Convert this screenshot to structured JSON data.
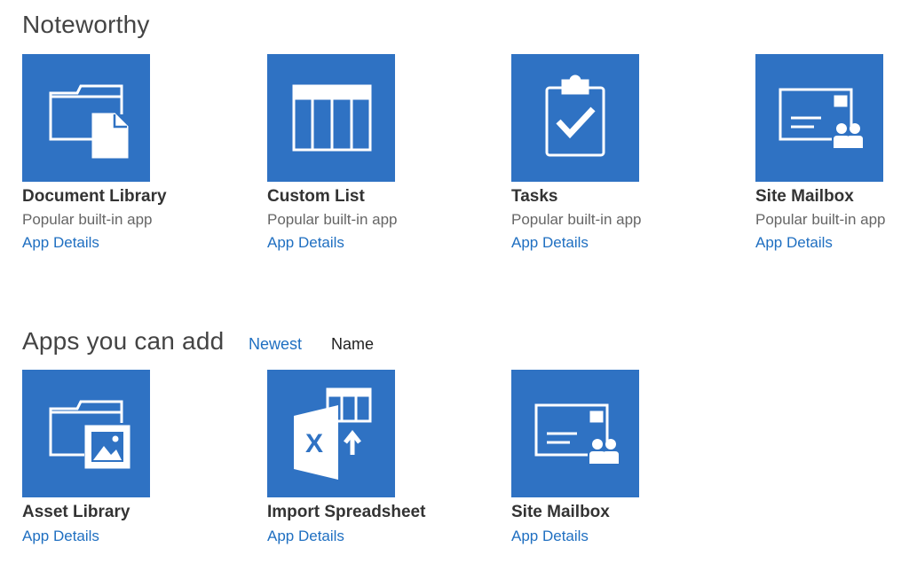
{
  "noteworthy": {
    "heading": "Noteworthy",
    "tiles": [
      {
        "title": "Document Library",
        "subtitle": "Popular built-in app",
        "link": "App Details",
        "icon": "document-library-icon"
      },
      {
        "title": "Custom List",
        "subtitle": "Popular built-in app",
        "link": "App Details",
        "icon": "custom-list-icon"
      },
      {
        "title": "Tasks",
        "subtitle": "Popular built-in app",
        "link": "App Details",
        "icon": "tasks-icon"
      },
      {
        "title": "Site Mailbox",
        "subtitle": "Popular built-in app",
        "link": "App Details",
        "icon": "site-mailbox-icon"
      }
    ]
  },
  "apps": {
    "heading": "Apps you can add",
    "sort_newest": "Newest",
    "sort_name": "Name",
    "tiles": [
      {
        "title": "Asset Library",
        "link": "App Details",
        "icon": "asset-library-icon"
      },
      {
        "title": "Import Spreadsheet",
        "link": "App Details",
        "icon": "import-spreadsheet-icon"
      },
      {
        "title": "Site Mailbox",
        "link": "App Details",
        "icon": "site-mailbox-icon"
      }
    ]
  },
  "colors": {
    "tile_bg": "#2f72c3",
    "link": "#1f6fc1",
    "text": "#333333"
  }
}
